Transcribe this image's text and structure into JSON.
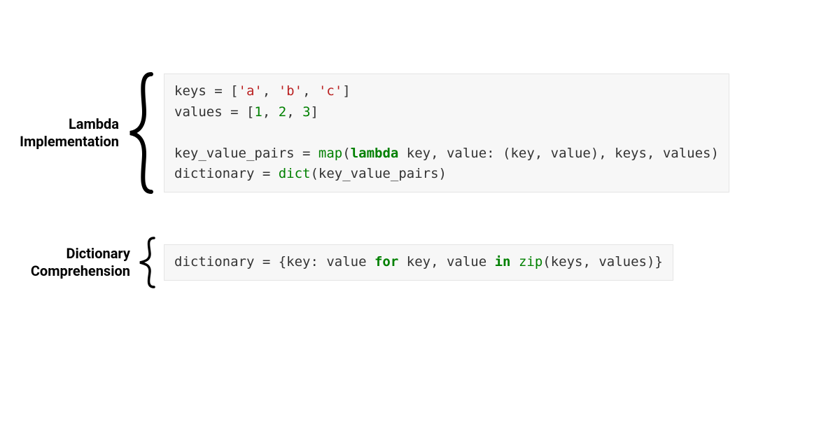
{
  "section1": {
    "label_line1": "Lambda",
    "label_line2": "Implementation",
    "code": {
      "t1": "keys = [",
      "s_a": "'a'",
      "c1": ", ",
      "s_b": "'b'",
      "c2": ", ",
      "s_c": "'c'",
      "t2": "]",
      "t3": "values = [",
      "n1": "1",
      "c3": ", ",
      "n2": "2",
      "c4": ", ",
      "n3": "3",
      "t4": "]",
      "blank": "",
      "t5": "key_value_pairs = ",
      "b_map": "map",
      "t6": "(",
      "kw_lambda": "lambda",
      "t7": " key, value: (key, value), keys, values)",
      "t8": "dictionary = ",
      "b_dict": "dict",
      "t9": "(key_value_pairs)"
    }
  },
  "section2": {
    "label_line1": "Dictionary",
    "label_line2": "Comprehension",
    "code": {
      "t1": "dictionary = {key: value ",
      "kw_for": "for",
      "t2": " key, value ",
      "kw_in": "in",
      "t3": " ",
      "b_zip": "zip",
      "t4": "(keys, values)}"
    }
  }
}
